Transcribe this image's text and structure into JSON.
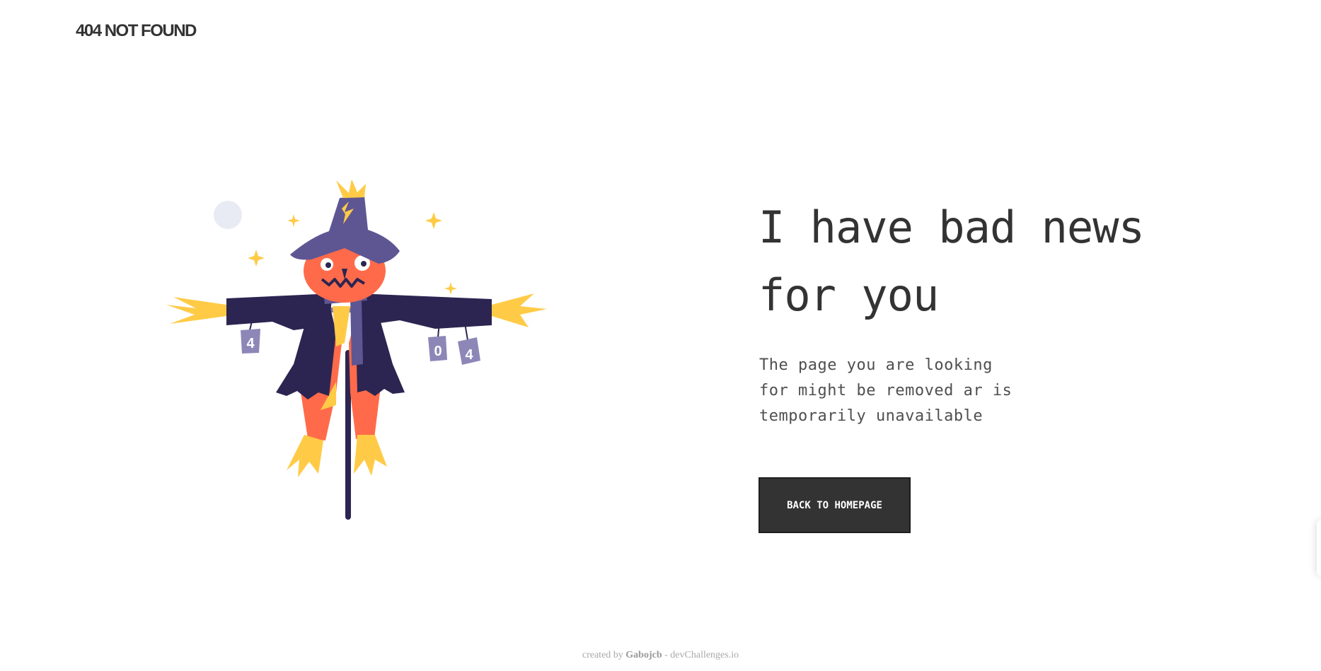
{
  "brand": {
    "title": "404 NOT FOUND"
  },
  "main": {
    "headline_line1": "I have bad news",
    "headline_line2": "for you",
    "subtext_line1": "The page you are looking",
    "subtext_line2": "for might be removed ar is",
    "subtext_line3": "temporarily unavailable",
    "button_label": "BACK TO HOMEPAGE"
  },
  "illustration": {
    "can_left": "4",
    "can_middle": "0",
    "can_right": "4"
  },
  "footer": {
    "prefix": "created by ",
    "author": "Gabojcb",
    "suffix": " - devChallenges.io"
  },
  "colors": {
    "text": "#333333",
    "button_bg": "#333333",
    "scarecrow_jacket": "#2c2551",
    "scarecrow_hat": "#5e5693",
    "scarecrow_face": "#ff6b4a",
    "straw": "#ffcb47",
    "moon": "#e8ebf4"
  }
}
